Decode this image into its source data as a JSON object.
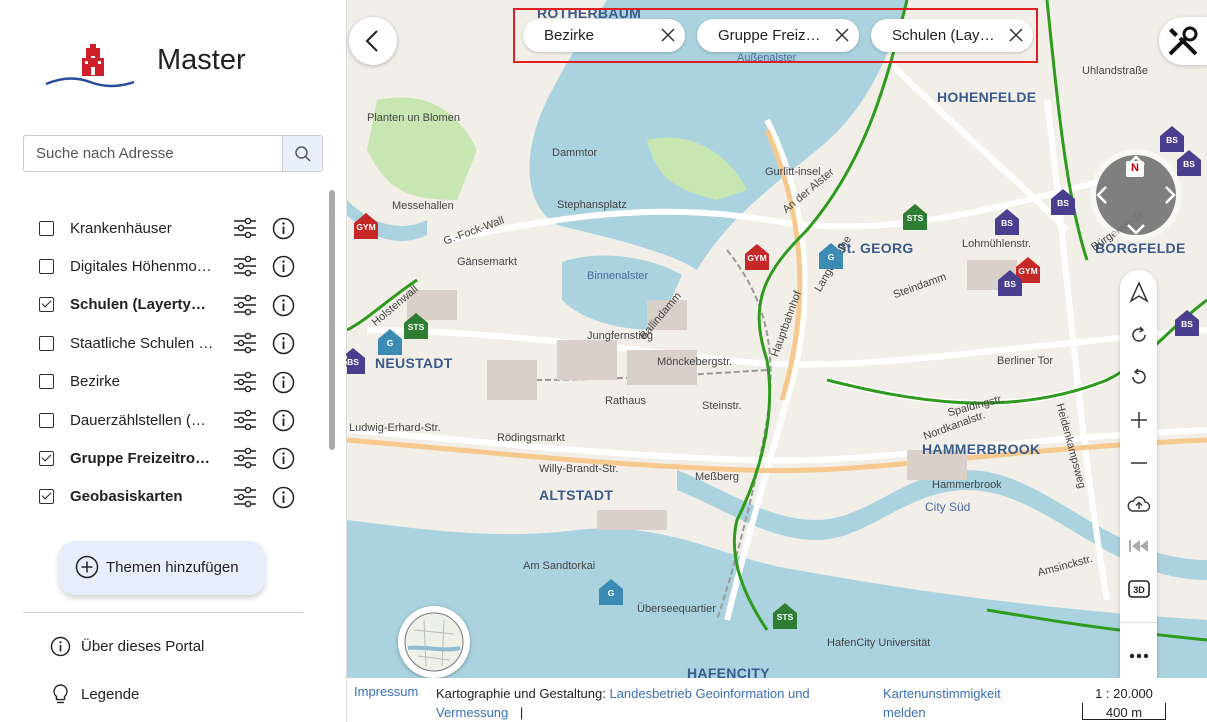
{
  "portal": {
    "title": "Master"
  },
  "search": {
    "placeholder": "Suche nach Adresse"
  },
  "layers": [
    {
      "name": "Krankenhäuser",
      "checked": false,
      "bold": false
    },
    {
      "name": "Digitales Höhenmodell",
      "checked": false,
      "bold": false
    },
    {
      "name": "Schulen (Layertyp WMS)",
      "checked": true,
      "bold": true
    },
    {
      "name": "Staatliche Schulen (WMS)",
      "checked": false,
      "bold": false
    },
    {
      "name": "Bezirke",
      "checked": false,
      "bold": false
    },
    {
      "name": "Dauerzählstellen (Rad)",
      "checked": false,
      "bold": false
    },
    {
      "name": "Gruppe Freizeitrouten",
      "checked": true,
      "bold": true
    },
    {
      "name": "Geobasiskarten",
      "checked": true,
      "bold": true
    }
  ],
  "add_topics": {
    "label": "Themen hinzufügen"
  },
  "footer_menu": {
    "about": "Über dieses Portal",
    "legend": "Legende"
  },
  "chips": [
    {
      "label": "Bezirke"
    },
    {
      "label": "Gruppe Freizeitrouten"
    },
    {
      "label": "Schulen (Layertyp WMS)"
    }
  ],
  "map": {
    "districts": [
      "ROTHERBAUM",
      "HOHENFELDE",
      "St. GEORG",
      "BORGFELDE",
      "NEUSTADT",
      "HAMMERBROOK",
      "ALTSTADT",
      "HAFENCITY"
    ],
    "labels": [
      "Außenalster",
      "Binnenalster",
      "Planten un Blomen",
      "Gurlitt-insel",
      "Stephansplatz",
      "Gänsemarkt",
      "Jungfernstieg",
      "Ballindamm",
      "Mönckebergstr.",
      "Rathaus",
      "Steinstr.",
      "Rödingsmarkt",
      "Willy-Brandt-Str.",
      "Ludwig-Erhard-Str.",
      "Am Sandtorkai",
      "Meßberg",
      "City Süd",
      "Amsinckstr.",
      "Spaldingstr.",
      "Nordkanalstr.",
      "Hammerbrook",
      "Steindamm",
      "Lange Reihe",
      "An der Alster",
      "G.-Fock-Wall",
      "Holstenwall",
      "Dammtor",
      "Uhlandstraße",
      "Lohmühlenstr.",
      "Berliner Tor",
      "HafenCity Universität",
      "Überseequartier",
      "Messehallen",
      "Hauptbahnhof",
      "Heidenkampsweg",
      "Bürgerweide"
    ],
    "poi_labels": [
      "GYM",
      "STS",
      "G",
      "BS",
      "N"
    ]
  },
  "footer": {
    "imprint": "Impressum",
    "carto_prefix": "Kartographie und Gestaltung:",
    "carto_link": "Landesbetrieb Geoinformation und Vermessung",
    "carto_sep": "|",
    "report": "Kartenunstimmigkeit melden",
    "scale": "1 : 20.000",
    "scale_bar": "400 m"
  },
  "colors": {
    "accent": "#3a6fb5",
    "route": "#2e9a1e",
    "water": "#aad3df",
    "highlight": "#e02020"
  }
}
